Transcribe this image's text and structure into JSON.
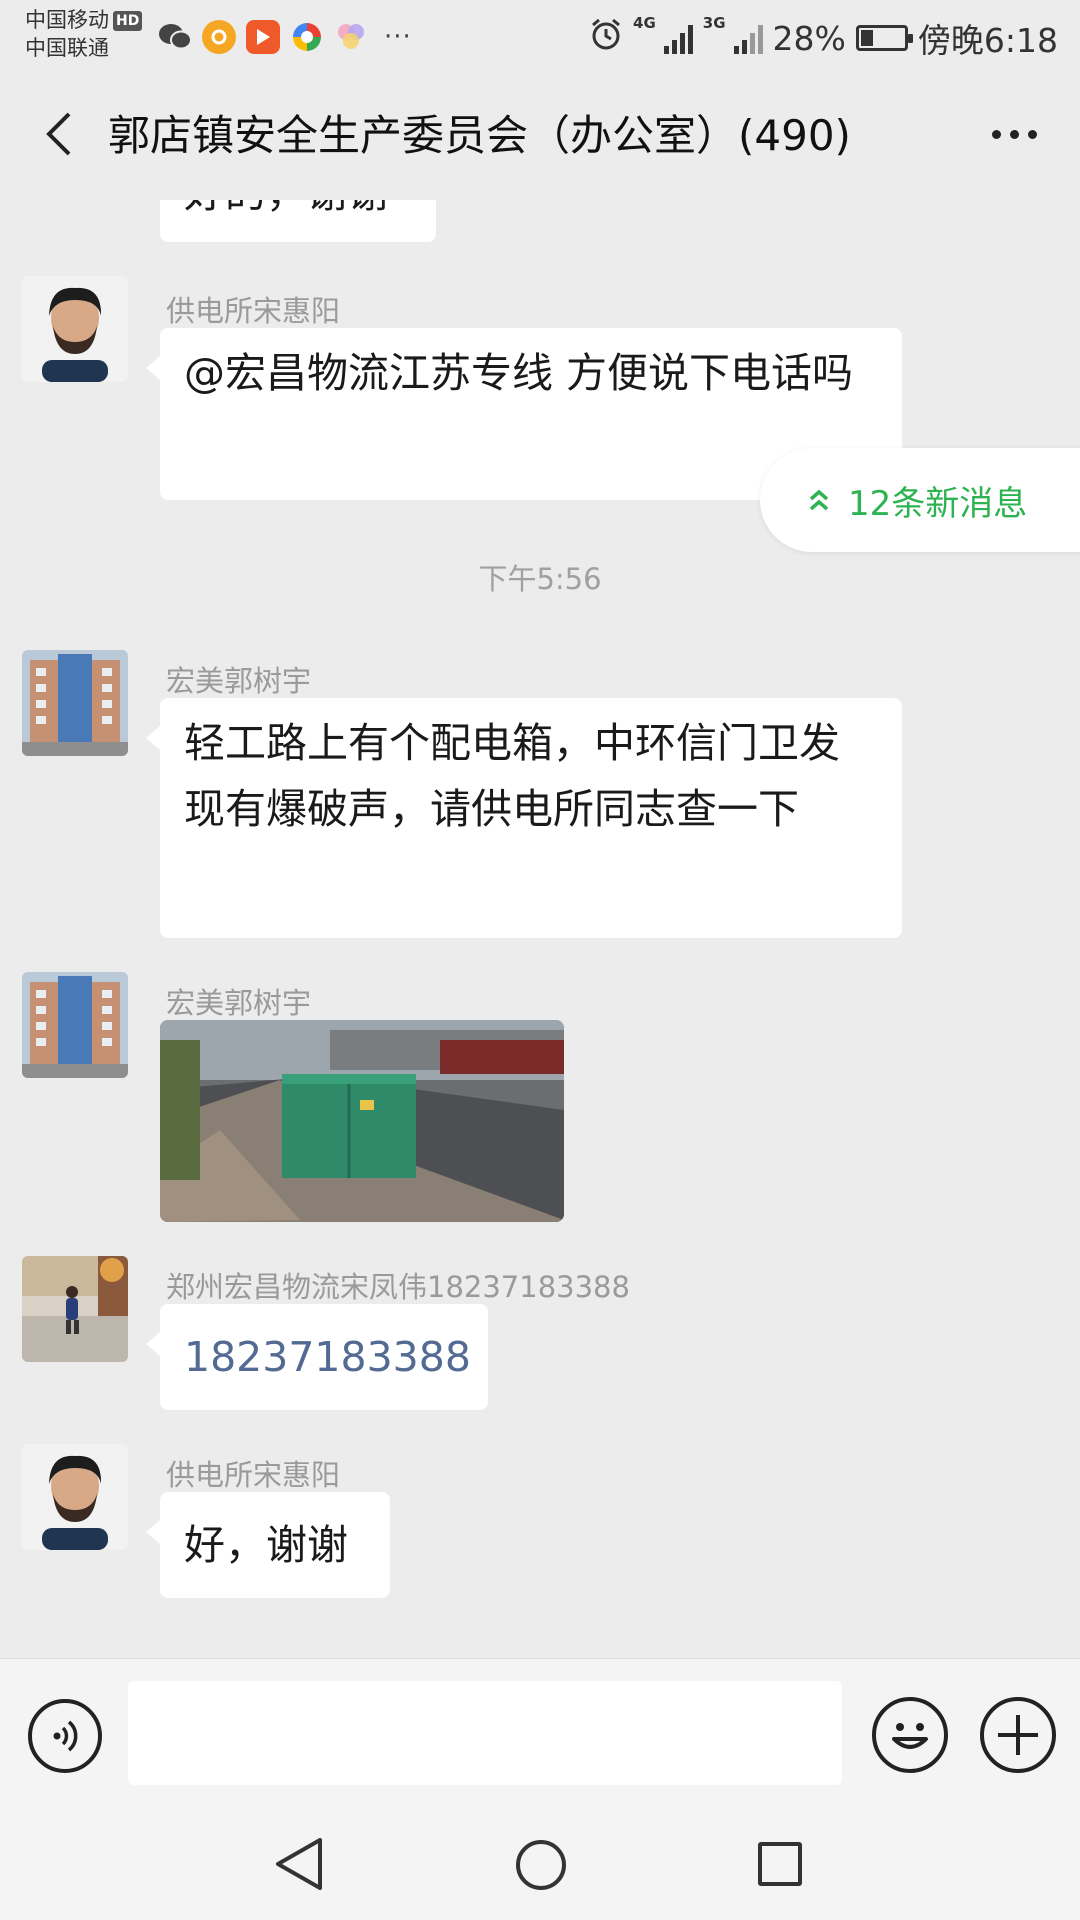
{
  "status_bar": {
    "carrier_1": "中国移动",
    "carrier_1_badge": "HD",
    "carrier_2": "中国联通",
    "overflow": "···",
    "net_1": "4G",
    "net_2": "3G",
    "battery": "28%",
    "battery_level": 0.28,
    "time": "傍晚6:18",
    "icons": [
      "wechat-icon",
      "app-orange-icon",
      "video-app-icon",
      "browser-icon",
      "photos-icon",
      "alarm-icon"
    ]
  },
  "header": {
    "title": "郭店镇安全生产委员会（办公室）(490)"
  },
  "chat": {
    "partial_text": "好的，谢谢",
    "new_messages": "12条新消息",
    "messages": [
      {
        "sender": "供电所宋惠阳",
        "text": "@宏昌物流江苏专线  方便说下电话吗"
      },
      {
        "timestamp": "下午5:56"
      },
      {
        "sender": "宏美郭树宇",
        "text": "轻工路上有个配电箱，中环信门卫发现有爆破声，请供电所同志查一下"
      },
      {
        "sender": "宏美郭树宇",
        "type": "image"
      },
      {
        "sender": "郑州宏昌物流宋凤伟18237183388",
        "text": "18237183388"
      },
      {
        "sender": "供电所宋惠阳",
        "text": "好，谢谢"
      }
    ]
  },
  "input": {
    "value": "",
    "placeholder": ""
  }
}
